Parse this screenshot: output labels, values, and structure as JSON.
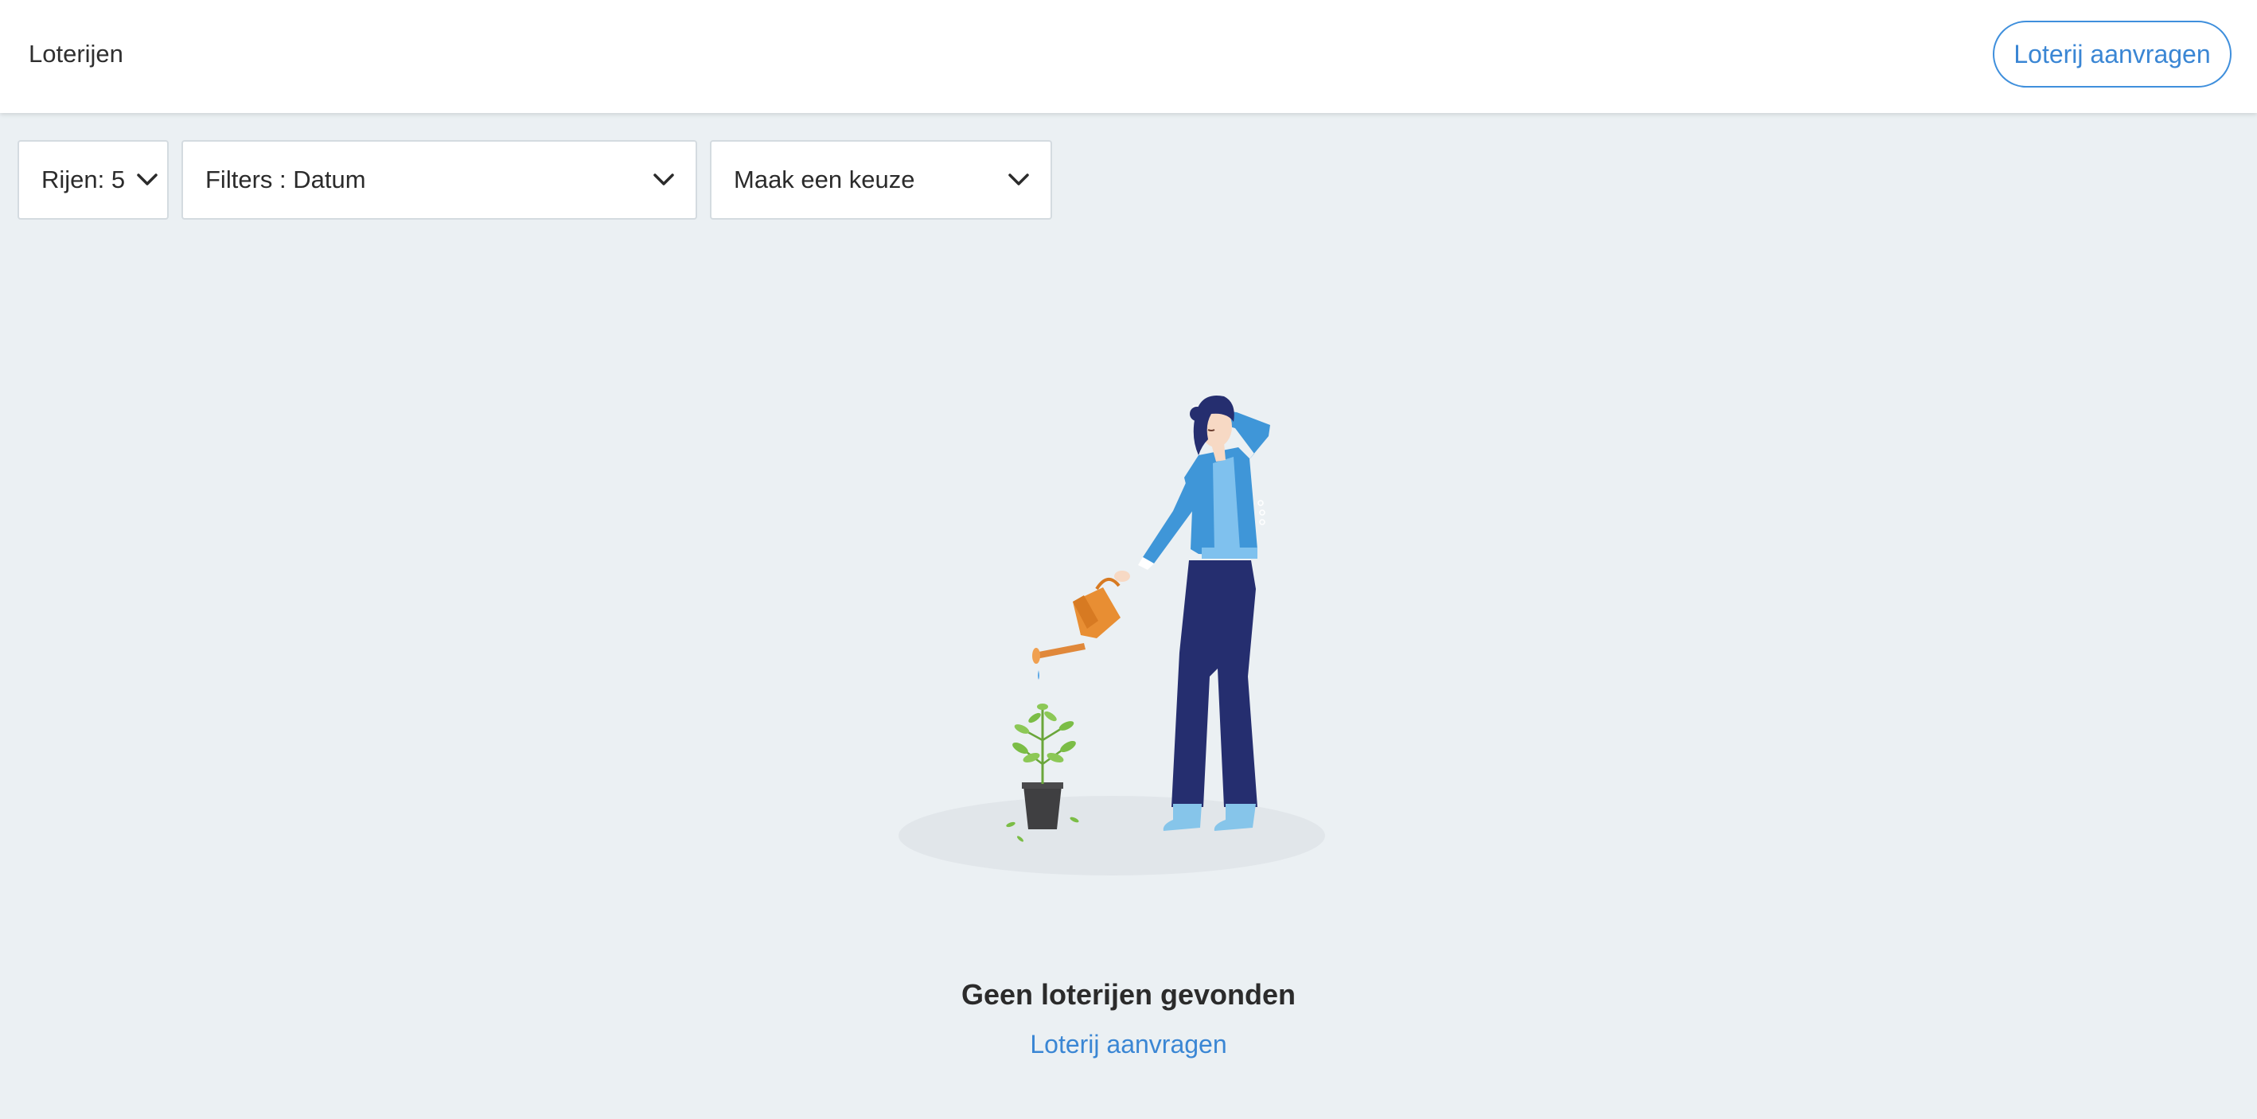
{
  "header": {
    "title": "Loterijen",
    "request_button_label": "Loterij aanvragen"
  },
  "toolbar": {
    "rows_label": "Rijen: 5",
    "filter_label": "Filters : Datum",
    "choice_label": "Maak een keuze"
  },
  "empty_state": {
    "illustration": "woman-watering-plant-illustration",
    "heading": "Geen loterijen gevonden",
    "link_label": "Loterij aanvragen"
  },
  "colors": {
    "accent": "#3a86d4",
    "background": "#ebf0f3",
    "header_background": "#ffffff"
  },
  "icons": {
    "dropdown": "chevron-down-icon"
  }
}
